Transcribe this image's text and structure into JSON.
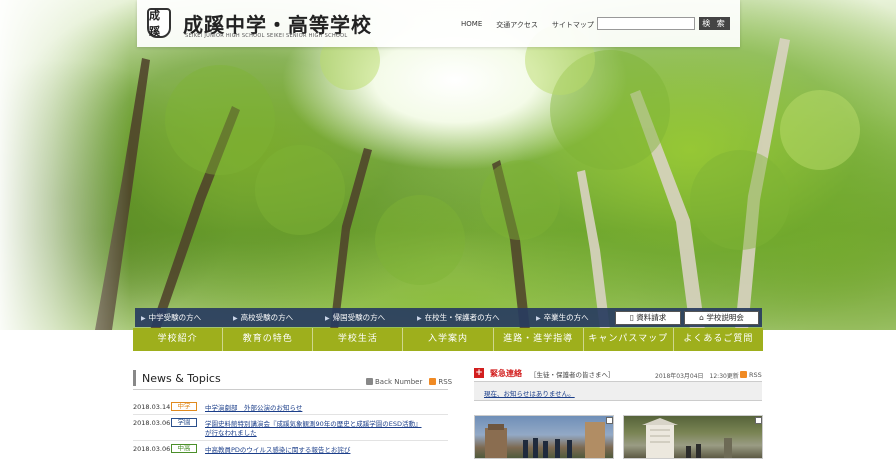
{
  "header": {
    "emblem_text": "成蹊",
    "school_name": "成蹊中学・高等学校",
    "school_name_en": "SEIKEI JUNIOR HIGH SCHOOL   SEIKEI SENIOR HIGH SCHOOL",
    "links": [
      "HOME",
      "交通アクセス",
      "サイトマップ"
    ],
    "search_placeholder": "",
    "search_button": "検 索"
  },
  "nav_dark": {
    "items": [
      "中学受験の方へ",
      "高校受験の方へ",
      "帰国受験の方へ",
      "在校生・保護者の方へ",
      "卒業生の方へ"
    ],
    "request_button": "資料請求",
    "briefing_button": "学校説明会"
  },
  "nav_green": {
    "items": [
      "学校紹介",
      "教育の特色",
      "学校生活",
      "入学案内",
      "進路・進学指導",
      "キャンパスマップ",
      "よくあるご質問"
    ]
  },
  "news": {
    "title": "News & Topics",
    "back_number": "Back Number",
    "rss": "RSS",
    "items": [
      {
        "date": "2018.03.14",
        "category": "中学",
        "text": "中学演劇部　外部公演のお知らせ"
      },
      {
        "date": "2018.03.06",
        "category": "学園",
        "text": "学園史料館特別講演会『成蹊気象観測90年の歴史と成蹊学園のESD活動』"
      },
      {
        "date": "",
        "category": "",
        "text": "が行なわれました"
      },
      {
        "date": "2018.03.06",
        "category": "中高",
        "text": "中高教員PDのウイルス感染に関する報告とお詫び"
      }
    ]
  },
  "emergency": {
    "icon": "+",
    "title": "緊急連絡",
    "subtitle": "［生徒・保護者の皆さまへ］",
    "updated": "2018年03月04日　12:30更新",
    "rss": "RSS",
    "message": "現在、お知らせはありません。"
  },
  "colors": {
    "nav_dark_bg": "#283c5f",
    "nav_green_bg": "#9eaf1c",
    "category_junior": "#e08a1e",
    "category_academy": "#2a4f8c",
    "category_combined": "#4b8f2a",
    "emergency_red": "#d21e1e"
  }
}
